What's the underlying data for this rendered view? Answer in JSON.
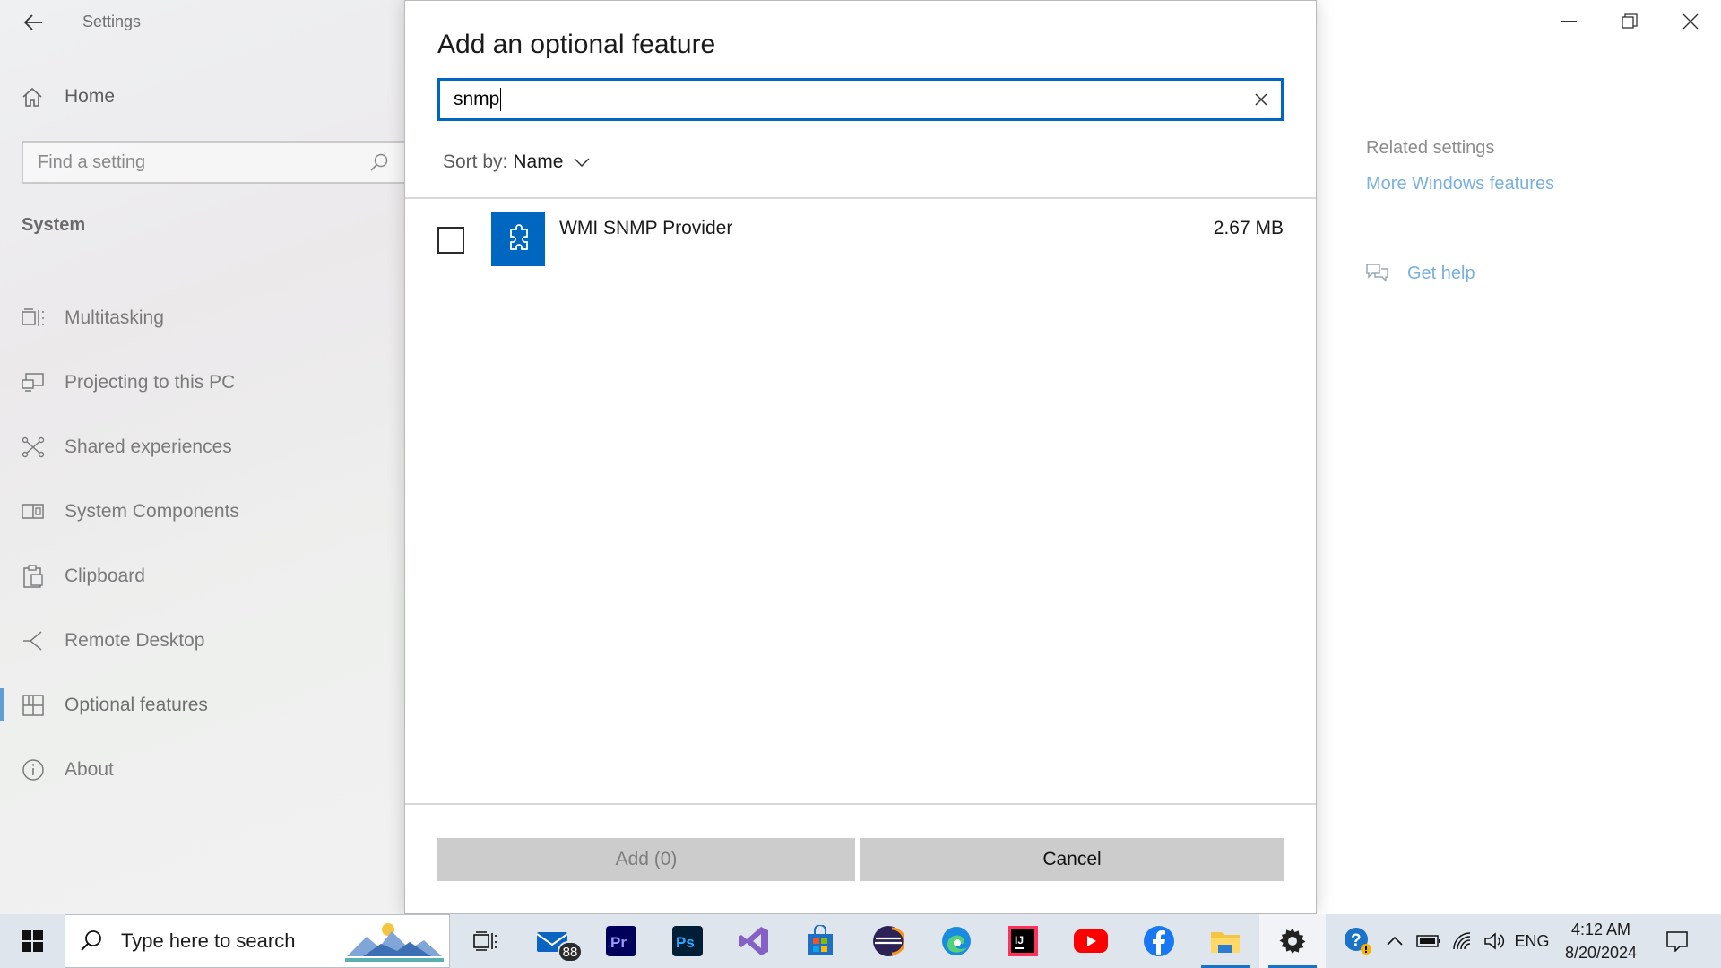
{
  "settings": {
    "app_title": "Settings",
    "home_label": "Home",
    "find_placeholder": "Find a setting",
    "group_title": "System",
    "nav": [
      {
        "label": "Multitasking",
        "icon": "multitasking-icon"
      },
      {
        "label": "Projecting to this PC",
        "icon": "projecting-icon"
      },
      {
        "label": "Shared experiences",
        "icon": "shared-experiences-icon"
      },
      {
        "label": "System Components",
        "icon": "system-components-icon"
      },
      {
        "label": "Clipboard",
        "icon": "clipboard-icon"
      },
      {
        "label": "Remote Desktop",
        "icon": "remote-desktop-icon"
      },
      {
        "label": "Optional features",
        "icon": "optional-features-icon",
        "selected": true
      },
      {
        "label": "About",
        "icon": "info-icon"
      }
    ],
    "related_title": "Related settings",
    "related_link": "More Windows features",
    "get_help": "Get help"
  },
  "dialog": {
    "title": "Add an optional feature",
    "search_value": "snmp",
    "sort_label": "Sort by:",
    "sort_value": "Name",
    "features": [
      {
        "name": "WMI SNMP Provider",
        "size": "2.67 MB",
        "checked": false
      }
    ],
    "add_button": "Add (0)",
    "cancel_button": "Cancel"
  },
  "taskbar": {
    "search_placeholder": "Type here to search",
    "mail_badge": "88",
    "apps": [
      "task-view",
      "mail",
      "premiere-pro",
      "photoshop",
      "visual-studio",
      "microsoft-store",
      "eclipse",
      "edge",
      "intellij",
      "youtube",
      "facebook",
      "file-explorer",
      "settings"
    ],
    "language": "ENG",
    "time": "4:12 AM",
    "date": "8/20/2024"
  },
  "colors": {
    "accent": "#0067c0",
    "link": "#79b0e0"
  }
}
